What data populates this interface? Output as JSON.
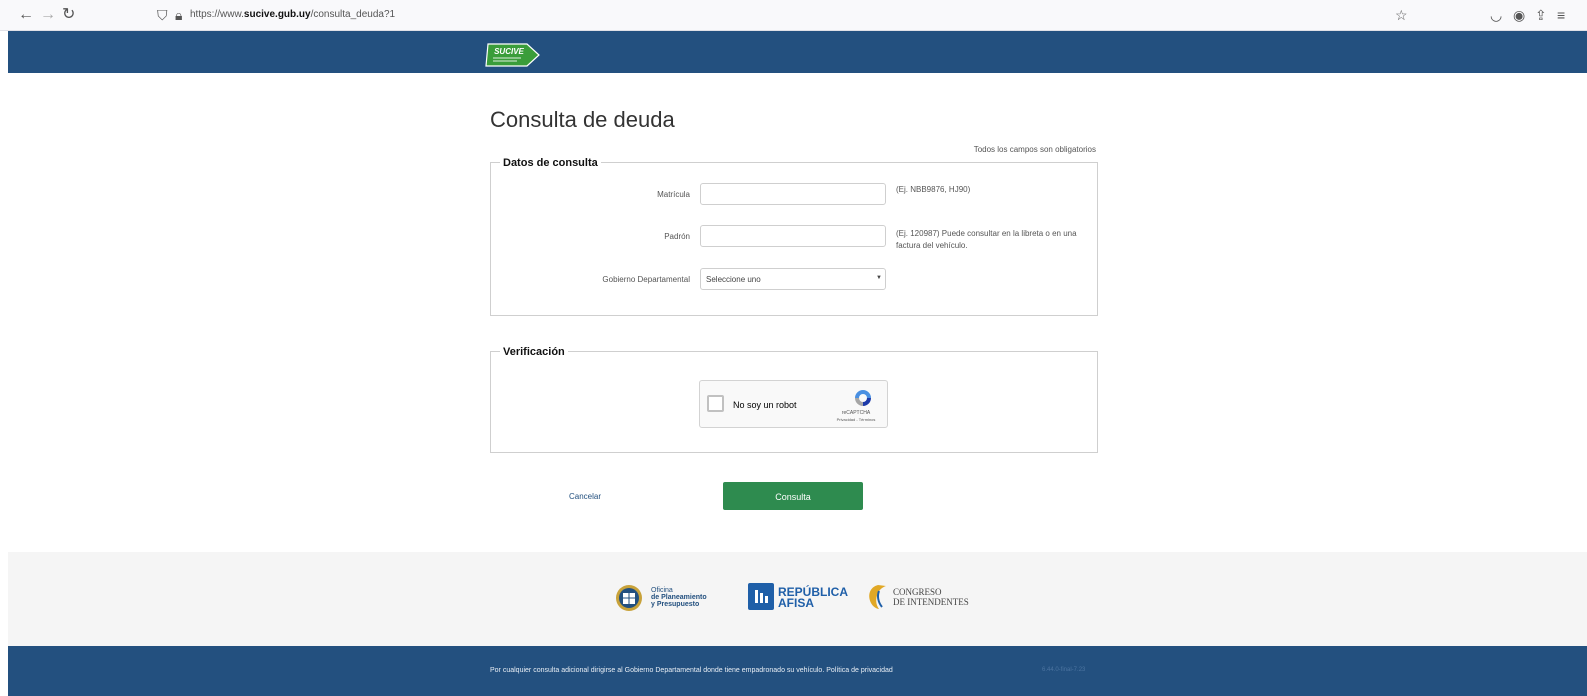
{
  "browser": {
    "url_prefix": "https://www.",
    "url_domain": "sucive.gub.uy",
    "url_path": "/consulta_deuda?1"
  },
  "header": {
    "logo_text": "SUCIVE"
  },
  "page": {
    "title": "Consulta de deuda",
    "required_note": "Todos los campos son obligatorios"
  },
  "datos": {
    "legend": "Datos de consulta",
    "matricula": {
      "label": "Matrícula",
      "value": "",
      "hint": "(Ej. NBB9876, HJ90)"
    },
    "padron": {
      "label": "Padrón",
      "value": "",
      "hint_1": "(Ej. 120987) Puede consultar en la libreta o en una",
      "hint_2": "factura del vehículo."
    },
    "gobierno": {
      "label": "Gobierno Departamental",
      "selected": "Seleccione uno"
    }
  },
  "verificacion": {
    "legend": "Verificación",
    "captcha_label": "No soy un robot",
    "captcha_brand": "reCAPTCHA",
    "captcha_links": "Privacidad - Términos"
  },
  "actions": {
    "cancel": "Cancelar",
    "submit": "Consulta"
  },
  "footer": {
    "opp_line1": "Oficina",
    "opp_line2": "de Planeamiento",
    "opp_line3": "y Presupuesto",
    "afisa_line1": "REPÚBLICA",
    "afisa_line2": "AFISA",
    "congreso_line1": "CONGRESO",
    "congreso_line2": "DE INTENDENTES",
    "note": "Por cualquier consulta adicional dirigirse al Gobierno Departamental donde tiene empadronado su vehículo.",
    "privacy_link": "Política de privacidad",
    "version": "6.44.0-final-7.23"
  },
  "colors": {
    "header_bg": "#23507f",
    "button_green": "#2e8b4f",
    "logo_green": "#3a9d3a"
  }
}
